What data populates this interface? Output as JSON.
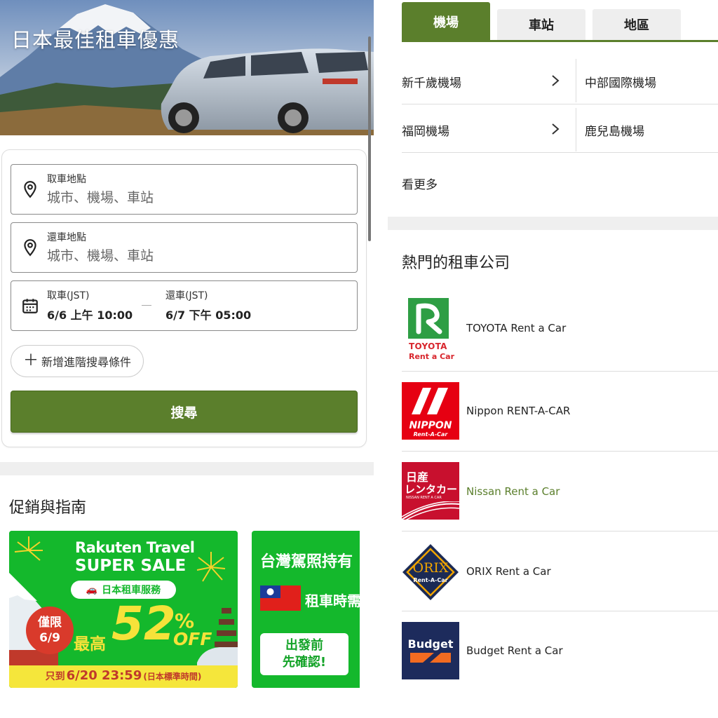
{
  "hero": {
    "title": "日本最佳租車優惠"
  },
  "form": {
    "pickup": {
      "label": "取車地點",
      "placeholder": "城市、機場、車站"
    },
    "dropoff": {
      "label": "還車地點",
      "placeholder": "城市、機場、車站"
    },
    "pickup_date": {
      "label": "取車(JST)",
      "value": "6/6 上午 10:00"
    },
    "return_date": {
      "label": "還車(JST)",
      "value": "6/7 下午 05:00"
    },
    "advanced_label": "新增進階搜尋條件",
    "search_label": "搜尋"
  },
  "promos": {
    "title": "促銷與指南",
    "card1": {
      "brand_line1": "Rakuten Travel",
      "brand_line2": "SUPER SALE",
      "service": "日本租車服務",
      "limit_line1": "僅限",
      "limit_line2": "6/9",
      "max_label": "最高",
      "percent": "52",
      "percent_sign": "%",
      "off": "OFF",
      "deadline_date": "6/20 23:59",
      "deadline_prefix": "只到",
      "deadline_suffix": "(日本標準時間)"
    },
    "card2": {
      "title": "台灣駕照持有",
      "subtitle": "租車時需",
      "cta_line1": "出發前",
      "cta_line2": "先確認!"
    }
  },
  "location_tabs": [
    {
      "label": "機場",
      "active": true
    },
    {
      "label": "車站",
      "active": false
    },
    {
      "label": "地區",
      "active": false
    }
  ],
  "airports": {
    "row1": {
      "left": "新千歲機場",
      "right": "中部國際機場"
    },
    "row2": {
      "left": "福岡機場",
      "right": "鹿兒島機場"
    },
    "more": "看更多"
  },
  "companies": {
    "title": "熱門的租車公司",
    "items": [
      {
        "name": "TOYOTA Rent a Car",
        "logo_text1": "TOYOTA",
        "logo_text2": "Rent a Car",
        "highlight": false
      },
      {
        "name": "Nippon RENT-A-CAR",
        "logo_text1": "NIPPON",
        "logo_text2": "Rent-A-Car",
        "highlight": false
      },
      {
        "name": "Nissan Rent a Car",
        "logo_text1": "日産",
        "logo_text2": "レンタカー",
        "logo_text3": "NISSAN RENT A CAR",
        "highlight": true
      },
      {
        "name": "ORIX Rent a Car",
        "logo_text1": "ORIX",
        "logo_text2": "Rent-A-Car",
        "highlight": false
      },
      {
        "name": "Budget Rent a Car",
        "logo_text1": "Budget",
        "highlight": false
      }
    ]
  },
  "colors": {
    "brand_green": "#5b7f2c",
    "promo_green": "#14b82c",
    "nissan_red": "#c8102e",
    "nippon_red": "#e60012",
    "budget_navy": "#1d2b5c",
    "budget_orange": "#f26b21"
  }
}
